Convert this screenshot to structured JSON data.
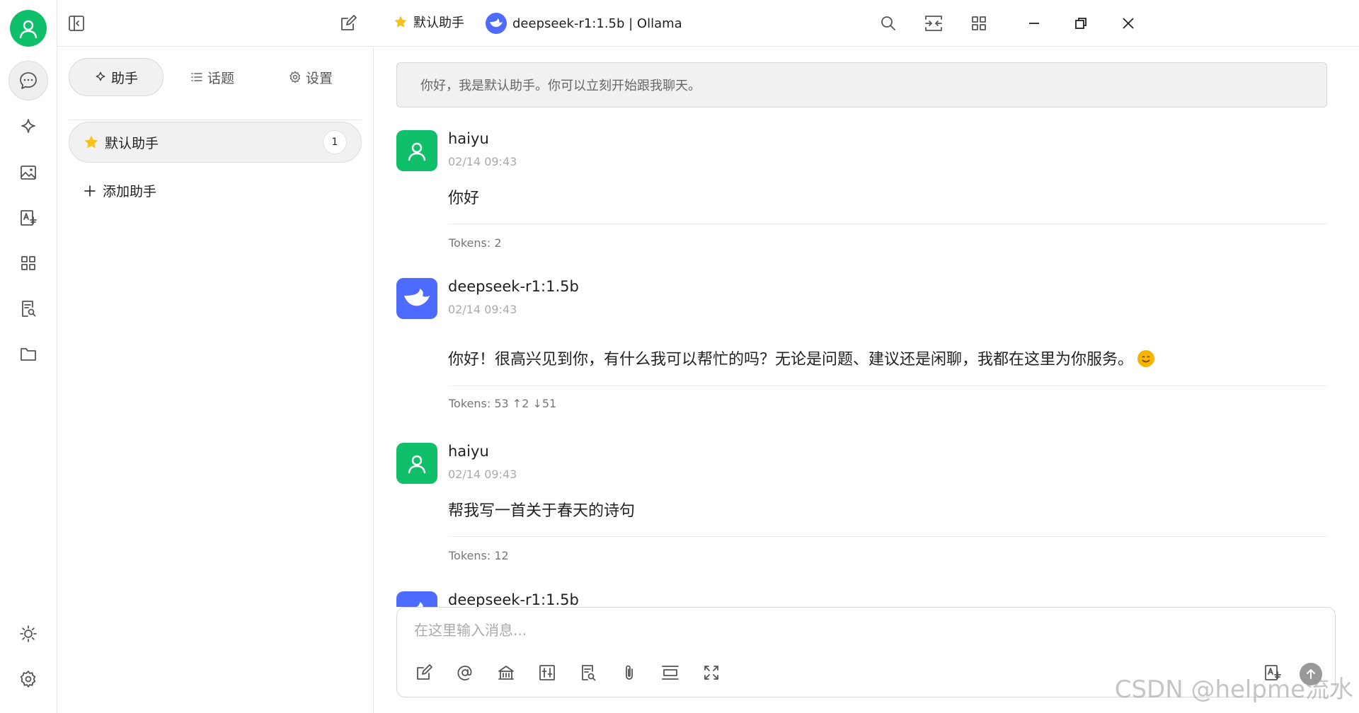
{
  "titlebar": {
    "assistant_name": "默认助手",
    "model_title": "deepseek-r1:1.5b | Ollama"
  },
  "panel": {
    "tabs": [
      {
        "label": "助手"
      },
      {
        "label": "话题"
      },
      {
        "label": "设置"
      }
    ],
    "assistant": {
      "name": "默认助手",
      "count": "1"
    },
    "add_label": "添加助手"
  },
  "chat": {
    "notice": "你好，我是默认助手。你可以立刻开始跟我聊天。",
    "messages": [
      {
        "name": "haiyu",
        "time": "02/14 09:43",
        "content": "你好",
        "tokens": "Tokens: 2"
      },
      {
        "name": "deepseek-r1:1.5b",
        "time": "02/14 09:43",
        "content": "你好！很高兴见到你，有什么我可以帮忙的吗？无论是问题、建议还是闲聊，我都在这里为你服务。",
        "tokens": "Tokens: 53 ↑2 ↓51"
      },
      {
        "name": "haiyu",
        "time": "02/14 09:43",
        "content": "帮我写一首关于春天的诗句",
        "tokens": "Tokens: 12"
      },
      {
        "name": "deepseek-r1:1.5b"
      }
    ]
  },
  "composer": {
    "placeholder": "在这里输入消息..."
  },
  "watermark": "CSDN @helpme流水",
  "colors": {
    "user_avatar": "#0fbf6a",
    "bot_avatar": "#4d6bfe",
    "star": "#f7c21c"
  }
}
